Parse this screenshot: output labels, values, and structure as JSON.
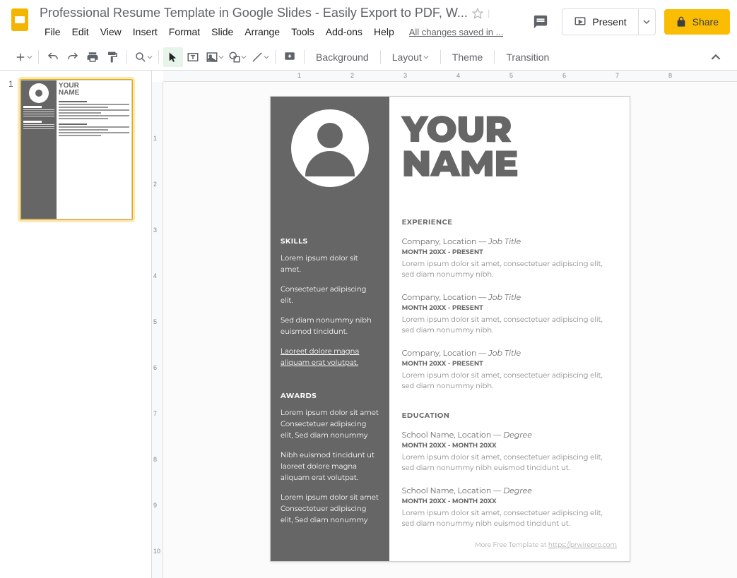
{
  "header": {
    "title": "Professional Resume Template in Google Slides - Easily Export to PDF, W...",
    "save_status": "All changes saved in ...",
    "present": "Present",
    "share": "Share"
  },
  "menu": [
    "File",
    "Edit",
    "View",
    "Insert",
    "Format",
    "Slide",
    "Arrange",
    "Tools",
    "Add-ons",
    "Help"
  ],
  "toolbar": {
    "background": "Background",
    "layout": "Layout",
    "theme": "Theme",
    "transition": "Transition"
  },
  "thumb": {
    "number": "1",
    "title1": "YOUR",
    "title2": "NAME"
  },
  "slide": {
    "name": "YOUR NAME",
    "skills_h": "SKILLS",
    "skills": [
      "Lorem ipsum dolor sit amet.",
      "Consectetuer adipiscing elit.",
      "Sed diam nonummy nibh euismod tincidunt.",
      "Laoreet dolore magna aliquam erat volutpat."
    ],
    "awards_h": "AWARDS",
    "awards": [
      "Lorem ipsum dolor sit amet Consectetuer adipiscing elit, Sed diam nonummy",
      "Nibh euismod tincidunt ut laoreet dolore magna aliquam erat volutpat.",
      "Lorem ipsum dolor sit amet Consectetuer adipiscing elit, Sed diam nonummy"
    ],
    "exp_h": "EXPERIENCE",
    "exp": [
      {
        "company": "Company, Location — ",
        "job": "Job Title",
        "date": "MONTH 20XX - PRESENT",
        "desc": "Lorem ipsum dolor sit amet, consectetuer adipiscing elit, sed diam nonummy nibh."
      },
      {
        "company": "Company, Location — ",
        "job": "Job Title",
        "date": "MONTH 20XX - PRESENT",
        "desc": "Lorem ipsum dolor sit amet, consectetuer adipiscing elit, sed diam nonummy nibh."
      },
      {
        "company": "Company, Location — ",
        "job": "Job Title",
        "date": "MONTH 20XX - PRESENT",
        "desc": "Lorem ipsum dolor sit amet, consectetuer adipiscing elit, sed diam nonummy nibh."
      }
    ],
    "edu_h": "EDUCATION",
    "edu": [
      {
        "school": "School Name, Location — ",
        "degree": "Degree",
        "date": "MONTH 20XX - MONTH 20XX",
        "desc": "Lorem ipsum dolor sit amet, consectetuer adipiscing elit, sed diam nonummy nibh euismod tincidunt ut."
      },
      {
        "school": "School Name, Location — ",
        "degree": "Degree",
        "date": "MONTH 20XX - MONTH 20XX",
        "desc": "Lorem ipsum dolor sit amet, consectetuer adipiscing elit, sed diam nonummy nibh euismod tincidunt ut."
      }
    ],
    "footer_text": "More Free Template at ",
    "footer_link": "https://prwirepro.com"
  },
  "ruler_h": [
    "1",
    "2",
    "3",
    "4",
    "5",
    "6",
    "7",
    "8"
  ],
  "ruler_v": [
    "1",
    "2",
    "3",
    "4",
    "5",
    "6",
    "7",
    "8",
    "9",
    "10"
  ]
}
